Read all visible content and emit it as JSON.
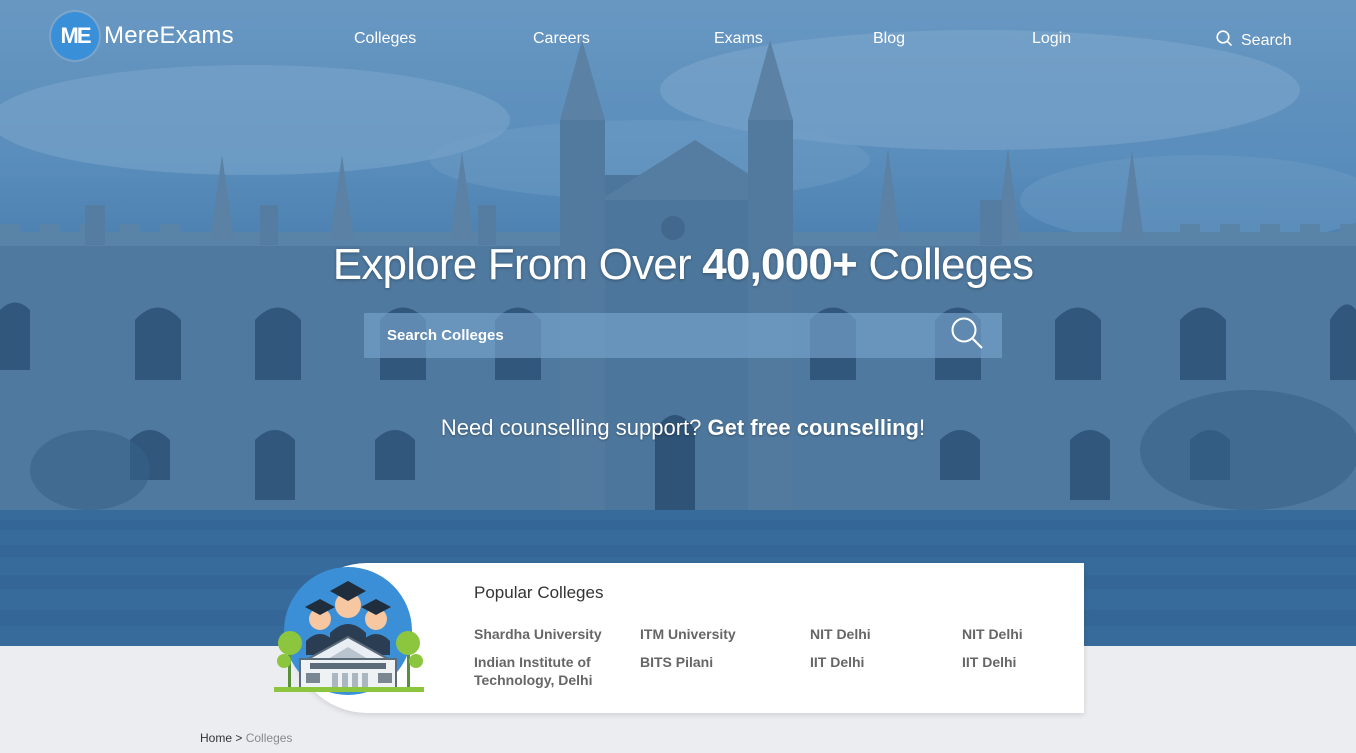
{
  "brand": {
    "mark": "ME",
    "name": "MereExams",
    "accent_color": "#3a8fd9"
  },
  "nav": {
    "items": [
      {
        "label": "Colleges"
      },
      {
        "label": "Careers"
      },
      {
        "label": "Exams"
      },
      {
        "label": "Blog"
      },
      {
        "label": "Login"
      }
    ],
    "search_label": "Search",
    "search_icon": "search-icon"
  },
  "hero": {
    "headline_pre": "Explore From Over ",
    "headline_bold": "40,000+",
    "headline_post": " Colleges",
    "search_placeholder": "Search Colleges",
    "counsel_text": "Need counselling support? ",
    "counsel_link": "Get free counselling",
    "counsel_suffix": "!"
  },
  "popular": {
    "title": "Popular Colleges",
    "colleges": [
      "Shardha University",
      "ITM University",
      "NIT Delhi",
      "NIT Delhi",
      "Indian Institute of Technology, Delhi",
      "BITS Pilani",
      "IIT Delhi",
      "IIT Delhi"
    ]
  },
  "breadcrumb": {
    "home": "Home",
    "separator": ">",
    "current": "Colleges"
  }
}
